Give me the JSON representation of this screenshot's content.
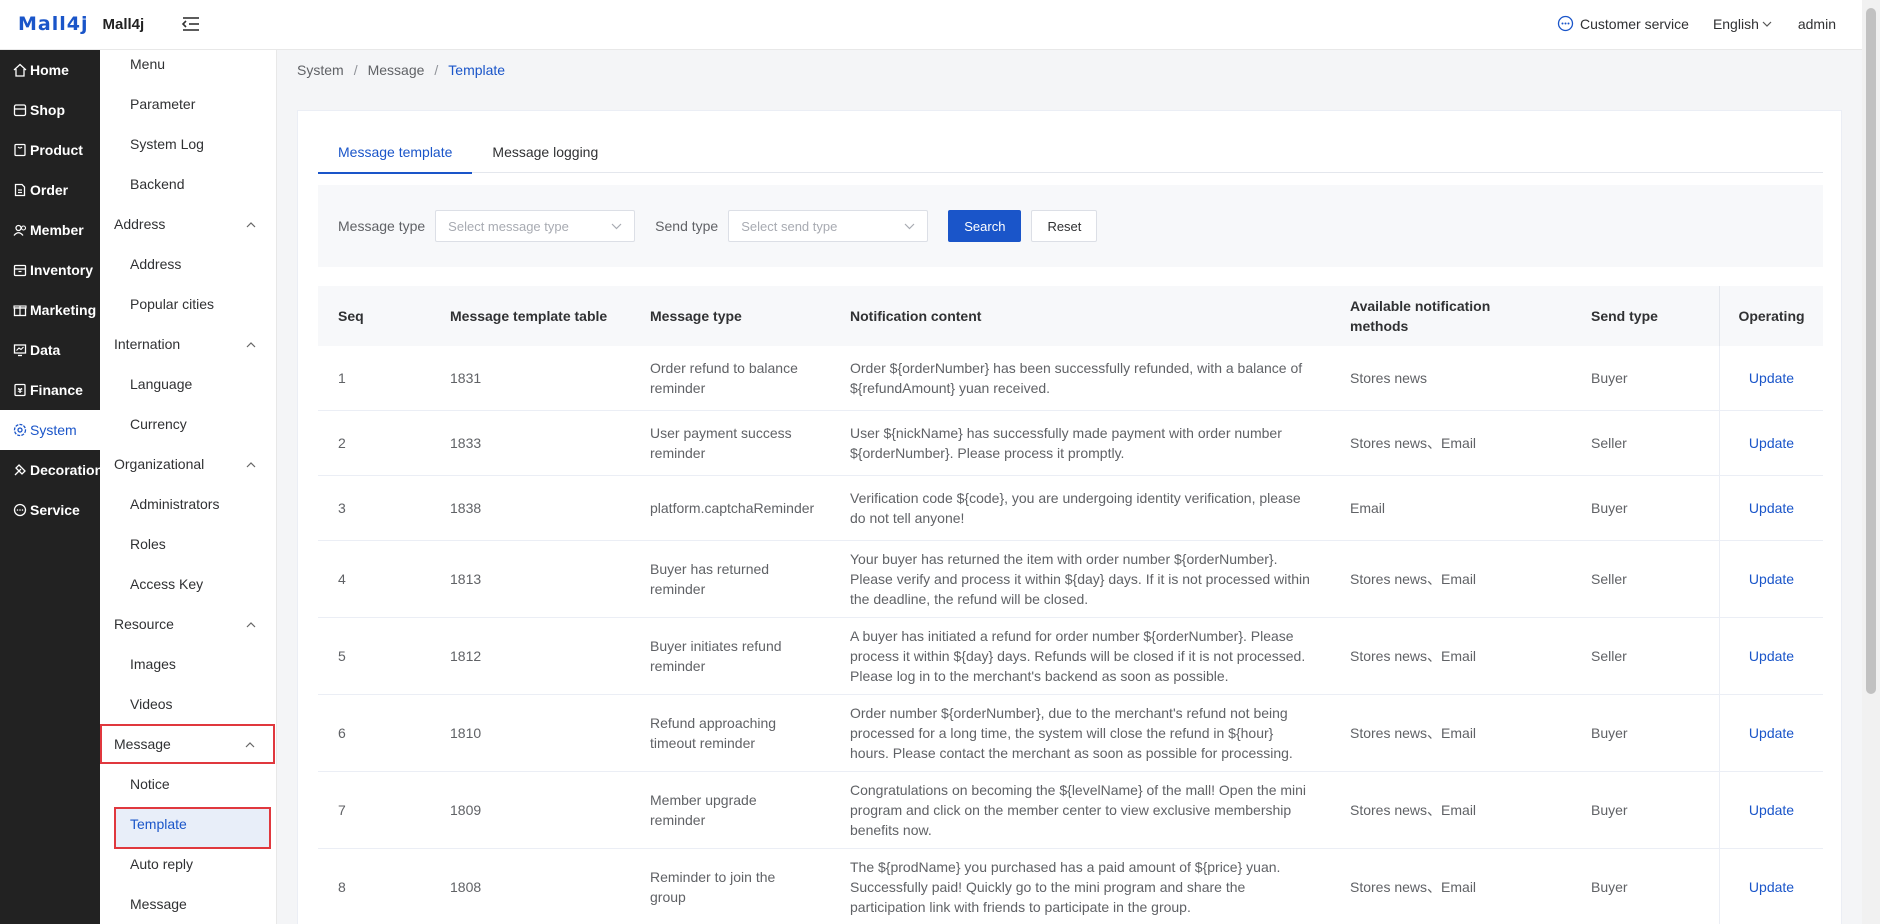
{
  "header": {
    "logo_mark": "Mall4j",
    "logo_text": "Mall4j",
    "customer_service": "Customer service",
    "language": "English",
    "user": "admin"
  },
  "sidebar": {
    "items": [
      {
        "label": "Home",
        "icon": "home-icon"
      },
      {
        "label": "Shop",
        "icon": "shop-icon"
      },
      {
        "label": "Product",
        "icon": "product-icon"
      },
      {
        "label": "Order",
        "icon": "order-icon"
      },
      {
        "label": "Member",
        "icon": "member-icon"
      },
      {
        "label": "Inventory",
        "icon": "inventory-icon"
      },
      {
        "label": "Marketing",
        "icon": "marketing-icon"
      },
      {
        "label": "Data",
        "icon": "data-icon"
      },
      {
        "label": "Finance",
        "icon": "finance-icon"
      },
      {
        "label": "System",
        "icon": "system-icon"
      },
      {
        "label": "Decoration",
        "icon": "decoration-icon"
      },
      {
        "label": "Service",
        "icon": "service-icon"
      }
    ]
  },
  "submenu": {
    "menu": "Menu",
    "parameter": "Parameter",
    "system_log": "System Log",
    "backend": "Backend",
    "address_group": "Address",
    "address": "Address",
    "popular_cities": "Popular cities",
    "internation_group": "Internation",
    "language": "Language",
    "currency": "Currency",
    "organizational_group": "Organizational",
    "administrators": "Administrators",
    "roles": "Roles",
    "access_key": "Access Key",
    "resource_group": "Resource",
    "images": "Images",
    "videos": "Videos",
    "message_group": "Message",
    "notice": "Notice",
    "template": "Template",
    "auto_reply": "Auto reply",
    "message": "Message"
  },
  "breadcrumb": {
    "system": "System",
    "message": "Message",
    "template": "Template",
    "sep": "/"
  },
  "tabs": {
    "message_template": "Message template",
    "message_logging": "Message logging"
  },
  "filter": {
    "message_type_label": "Message type",
    "message_type_placeholder": "Select message type",
    "send_type_label": "Send type",
    "send_type_placeholder": "Select send type",
    "search": "Search",
    "reset": "Reset"
  },
  "table": {
    "columns": [
      "Seq",
      "Message template table",
      "Message type",
      "Notification content",
      "Available notification methods",
      "Send type",
      "Operating"
    ],
    "rows": [
      {
        "seq": "1",
        "id": "1831",
        "type": "Order refund to balance reminder",
        "content": "Order ${orderNumber} has been successfully refunded, with a balance of ${refundAmount} yuan received.",
        "methods": "Stores news",
        "send": "Buyer",
        "op": "Update"
      },
      {
        "seq": "2",
        "id": "1833",
        "type": "User payment success reminder",
        "content": "User ${nickName} has successfully made payment with order number ${orderNumber}. Please process it promptly.",
        "methods": "Stores news、Email",
        "send": "Seller",
        "op": "Update"
      },
      {
        "seq": "3",
        "id": "1838",
        "type": "platform.captchaReminder",
        "content": "Verification code ${code}, you are undergoing identity verification, please do not tell anyone!",
        "methods": "Email",
        "send": "Buyer",
        "op": "Update"
      },
      {
        "seq": "4",
        "id": "1813",
        "type": "Buyer has returned reminder",
        "content": "Your buyer has returned the item with order number ${orderNumber}. Please verify and process it within ${day} days. If it is not processed within the deadline, the refund will be closed.",
        "methods": "Stores news、Email",
        "send": "Seller",
        "op": "Update"
      },
      {
        "seq": "5",
        "id": "1812",
        "type": "Buyer initiates refund reminder",
        "content": "A buyer has initiated a refund for order number ${orderNumber}. Please process it within ${day} days. Refunds will be closed if it is not processed. Please log in to the merchant's backend as soon as possible.",
        "methods": "Stores news、Email",
        "send": "Seller",
        "op": "Update"
      },
      {
        "seq": "6",
        "id": "1810",
        "type": "Refund approaching timeout reminder",
        "content": "Order number ${orderNumber}, due to the merchant's refund not being processed for a long time, the system will close the refund in ${hour} hours. Please contact the merchant as soon as possible for processing.",
        "methods": "Stores news、Email",
        "send": "Buyer",
        "op": "Update"
      },
      {
        "seq": "7",
        "id": "1809",
        "type": "Member upgrade reminder",
        "content": "Congratulations on becoming the ${levelName} of the mall! Open the mini program and click on the member center to view exclusive membership benefits now.",
        "methods": "Stores news、Email",
        "send": "Buyer",
        "op": "Update"
      },
      {
        "seq": "8",
        "id": "1808",
        "type": "Reminder to join the group",
        "content": "The ${prodName} you purchased has a paid amount of ${price} yuan. Successfully paid! Quickly go to the mini program and share the participation link with friends to participate in the group.",
        "methods": "Stores news、Email",
        "send": "Buyer",
        "op": "Update"
      }
    ]
  },
  "colors": {
    "primary": "#1a55c9",
    "sidebar_bg": "#222222",
    "highlight_border": "#e0383e"
  }
}
